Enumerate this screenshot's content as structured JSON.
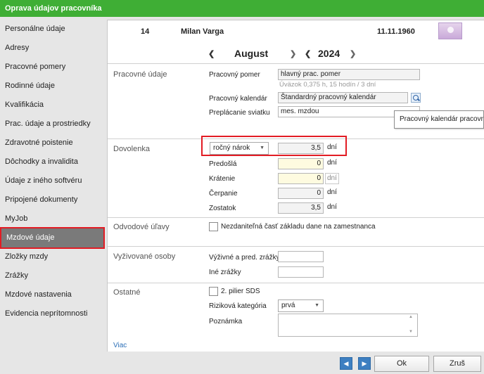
{
  "window": {
    "title": "Oprava údajov pracovníka"
  },
  "sidebar": {
    "items": [
      {
        "label": "Personálne údaje"
      },
      {
        "label": "Adresy"
      },
      {
        "label": "Pracovné pomery"
      },
      {
        "label": "Rodinné údaje"
      },
      {
        "label": "Kvalifikácia"
      },
      {
        "label": "Prac. údaje a prostriedky"
      },
      {
        "label": "Zdravotné poistenie"
      },
      {
        "label": "Dôchodky a invalidita"
      },
      {
        "label": "Údaje z iného softvéru"
      },
      {
        "label": "Pripojené dokumenty"
      },
      {
        "label": "MyJob"
      },
      {
        "label": "Mzdové údaje"
      },
      {
        "label": "Zložky mzdy"
      },
      {
        "label": "Zrážky"
      },
      {
        "label": "Mzdové nastavenia"
      },
      {
        "label": "Evidencia neprítomnosti"
      }
    ],
    "active_index": 11
  },
  "header": {
    "employee_number": "14",
    "employee_name": "Milan Varga",
    "birth_date": "11.11.1960",
    "month": "August",
    "year": "2024"
  },
  "pracovne_udaje": {
    "title": "Pracovné údaje",
    "pomer_label": "Pracovný pomer",
    "pomer_value": "hlavný prac. pomer",
    "pomer_hint": "Úväzok 0,375 h, 15 hodín  / 3 dní",
    "kalendar_label": "Pracovný kalendár",
    "kalendar_value": "Štandardný pracovný kalendár",
    "sviatok_label": "Preplácanie sviatku",
    "sviatok_value": "mes. mzdou",
    "tooltip": "Pracovný kalendár pracovníka"
  },
  "dovolenka": {
    "title": "Dovolenka",
    "type_value": "ročný nárok",
    "narok_value": "3,5",
    "unit": "dní",
    "predosla_label": "Predošlá",
    "predosla_value": "0",
    "kratenie_label": "Krátenie",
    "kratenie_value": "0",
    "cerpanie_label": "Čerpanie",
    "cerpanie_value": "0",
    "zostatok_label": "Zostatok",
    "zostatok_value": "3,5"
  },
  "odvodove": {
    "title": "Odvodové úľavy",
    "checkbox_label": "Nezdaniteľná časť základu dane na zamestnanca"
  },
  "vyzivovane": {
    "title": "Vyživované osoby",
    "vyzivne_label": "Výživné a pred. zrážky",
    "ine_label": "Iné zrážky"
  },
  "ostatne": {
    "title": "Ostatné",
    "pilier_label": "2. pilier SDS",
    "rizikova_label": "Riziková kategória",
    "rizikova_value": "prvá",
    "poznamka_label": "Poznámka",
    "viac_link": "Viac"
  },
  "footer": {
    "ok_label": "Ok",
    "cancel_label": "Zruš"
  },
  "colors": {
    "title_bar": "#3fae35",
    "highlight": "#e21c24",
    "active_item": "#7a7a7a",
    "nav_button": "#3d7fc1"
  }
}
